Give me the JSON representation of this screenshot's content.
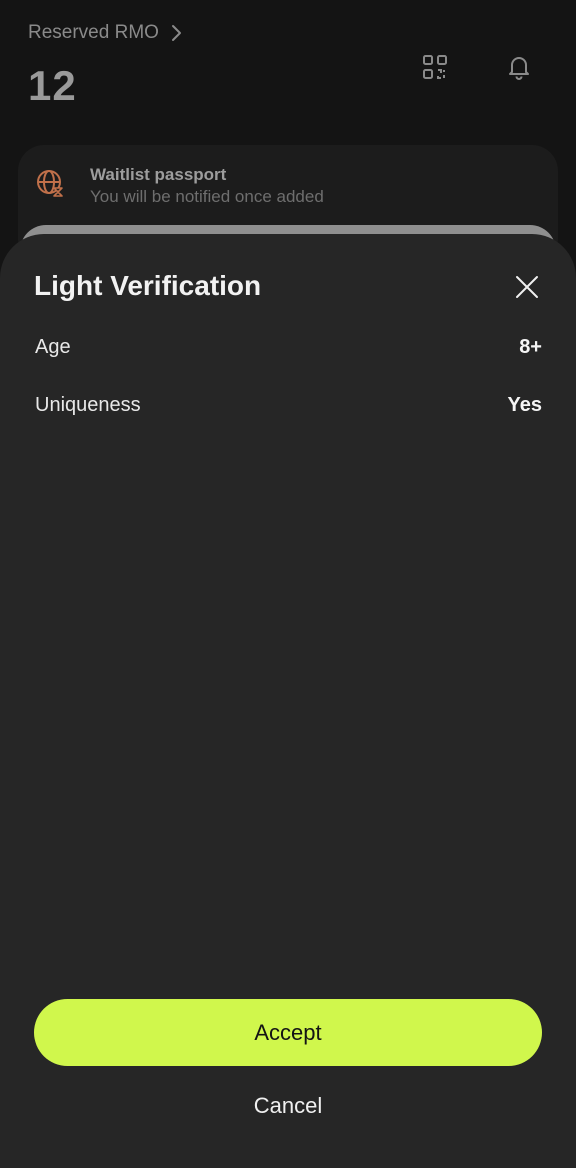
{
  "header": {
    "link_label": "Reserved RMO",
    "balance": "12"
  },
  "icons": {
    "chevron": "chevron-right-icon",
    "qr": "qr-code-icon",
    "bell": "bell-icon",
    "waitlist": "globe-hourglass-icon",
    "close": "close-icon"
  },
  "waitlist_card": {
    "title": "Waitlist passport",
    "subtitle": "You will be notified once added"
  },
  "sheet": {
    "title": "Light Verification",
    "rows": [
      {
        "label": "Age",
        "value": "8+"
      },
      {
        "label": "Uniqueness",
        "value": "Yes"
      }
    ],
    "accept_label": "Accept",
    "cancel_label": "Cancel"
  },
  "colors": {
    "background": "#141414",
    "sheet": "#262626",
    "accent": "#d0f74c",
    "waitlist_icon": "#c0704a"
  }
}
